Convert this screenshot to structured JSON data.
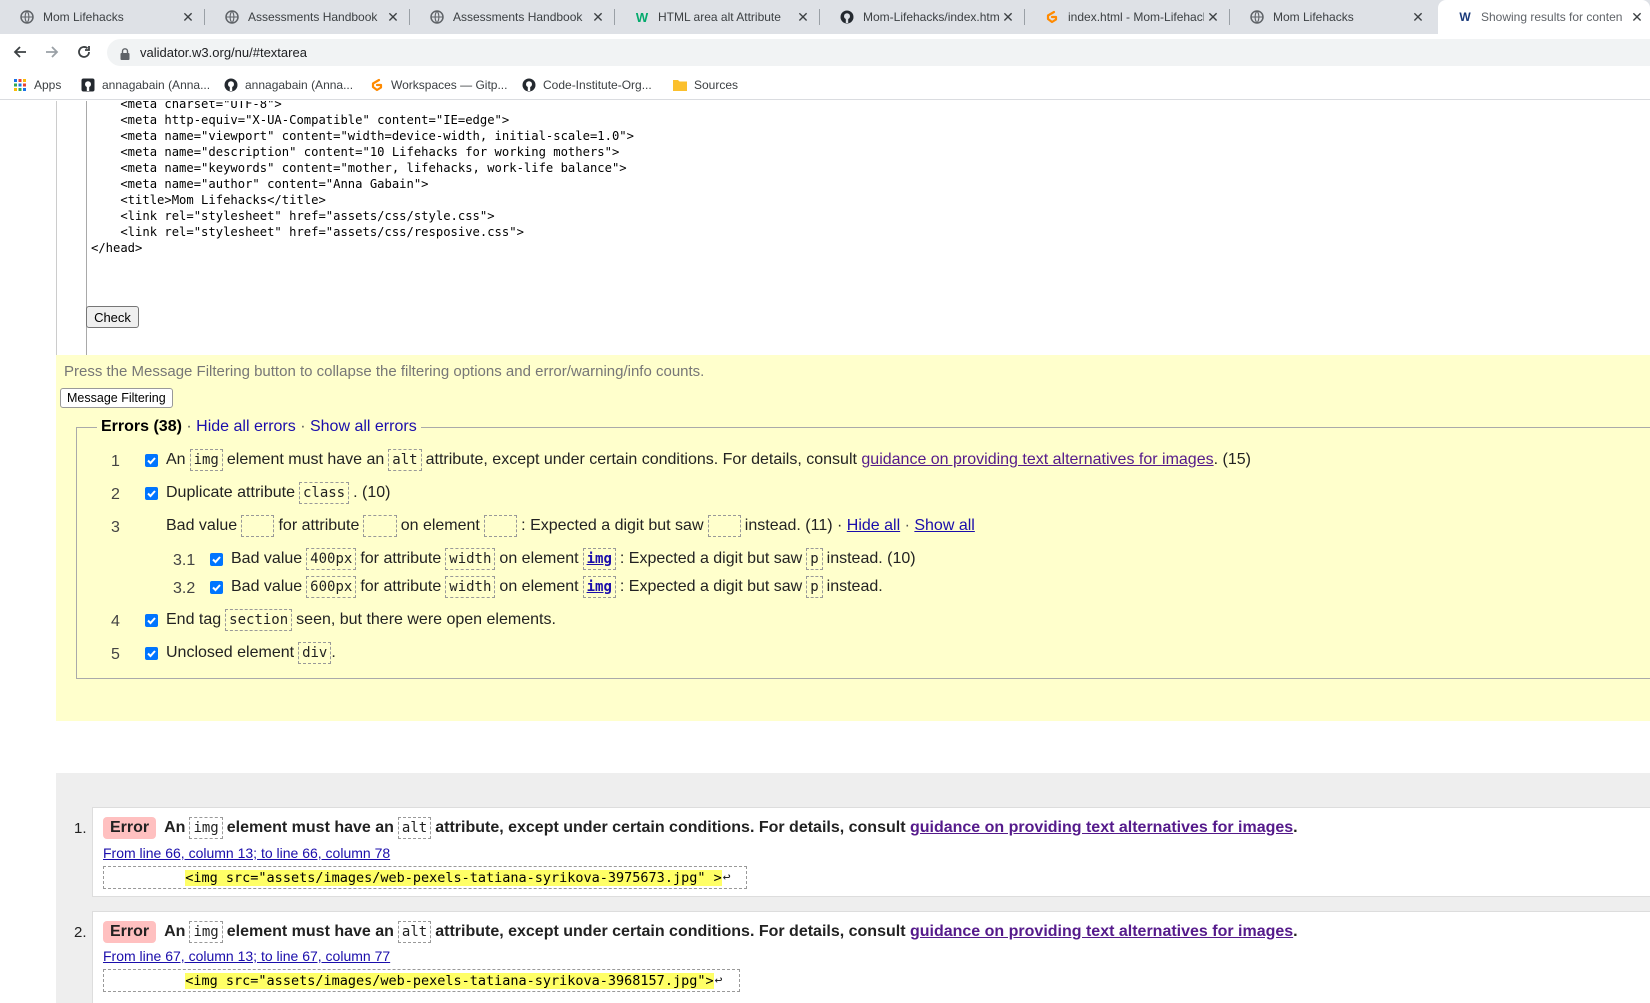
{
  "browser": {
    "tabs": [
      {
        "title": "Mom Lifehacks",
        "icon": "globe-icon"
      },
      {
        "title": "Assessments Handbook",
        "icon": "globe-icon"
      },
      {
        "title": "Assessments Handbook",
        "icon": "globe-icon"
      },
      {
        "title": "HTML area alt Attribute",
        "icon": "w3schools-icon"
      },
      {
        "title": "Mom-Lifehacks/index.html",
        "icon": "github-icon"
      },
      {
        "title": "index.html - Mom-Lifehack",
        "icon": "gitpod-icon"
      },
      {
        "title": "Mom Lifehacks",
        "icon": "globe-icon"
      },
      {
        "title": "Showing results for conten",
        "icon": "w3c-icon"
      }
    ],
    "url": "validator.w3.org/nu/#textarea",
    "bookmarks": [
      {
        "label": "Apps",
        "icon": "apps-grid-icon"
      },
      {
        "label": "annagabain (Anna...",
        "icon": "github-icon"
      },
      {
        "label": "annagabain (Anna...",
        "icon": "github-icon"
      },
      {
        "label": "Workspaces — Gitp...",
        "icon": "gitpod-icon"
      },
      {
        "label": "Code-Institute-Org...",
        "icon": "github-icon"
      },
      {
        "label": "Sources",
        "icon": "folder-icon"
      }
    ]
  },
  "validator": {
    "source_lines": [
      "    <meta charset=\"UTF-8\">",
      "    <meta http-equiv=\"X-UA-Compatible\" content=\"IE=edge\">",
      "    <meta name=\"viewport\" content=\"width=device-width, initial-scale=1.0\">",
      "",
      "    <meta name=\"description\" content=\"10 Lifehacks for working mothers\">",
      "    <meta name=\"keywords\" content=\"mother, lifehacks, work-life balance\">",
      "    <meta name=\"author\" content=\"Anna Gabain\">",
      "    <title>Mom Lifehacks</title>",
      "",
      "    <link rel=\"stylesheet\" href=\"assets/css/style.css\">",
      "    <link rel=\"stylesheet\" href=\"assets/css/resposive.css\">",
      "</head>"
    ],
    "check_label": "Check",
    "filter_hint": "Press the Message Filtering button to collapse the filtering options and error/warning/info counts.",
    "filter_button": "Message Filtering",
    "errors_heading": "Errors (38)",
    "hide_all_errors": "Hide all errors",
    "show_all_errors": "Show all errors",
    "error_groups": {
      "g1": {
        "num": "1",
        "p1": "An",
        "code1": "img",
        "p2": "element must have an",
        "code2": "alt",
        "p3": "attribute, except under certain conditions. For details, consult",
        "link": "guidance on providing text alternatives for images",
        "p4": ". (15)"
      },
      "g2": {
        "num": "2",
        "p1": "Duplicate attribute",
        "code1": "class",
        "p2": ". (10)"
      },
      "g3": {
        "num": "3",
        "p1": "Bad value",
        "p2": "for attribute",
        "p3": "on element",
        "p4": ": Expected a digit but saw",
        "p5": "instead. (11) ·",
        "hide": "Hide all",
        "show": "Show all"
      },
      "g3_1": {
        "num": "3.1",
        "p1": "Bad value",
        "code1": "400px",
        "p2": "for attribute",
        "code2": "width",
        "p3": "on element",
        "code3": "img",
        "p4": ": Expected a digit but saw",
        "code4": "p",
        "p5": "instead. (10)"
      },
      "g3_2": {
        "num": "3.2",
        "p1": "Bad value",
        "code1": "600px",
        "p2": "for attribute",
        "code2": "width",
        "p3": "on element",
        "code3": "img",
        "p4": ": Expected a digit but saw",
        "code4": "p",
        "p5": "instead."
      },
      "g4": {
        "num": "4",
        "p1": "End tag",
        "code1": "section",
        "p2": "seen, but there were open elements."
      },
      "g5": {
        "num": "5",
        "p1": "Unclosed element",
        "code1": "div",
        "p2": "."
      }
    },
    "results": [
      {
        "index": "1.",
        "badge": "Error",
        "p1": "An",
        "code1": "img",
        "p2": "element must have an",
        "code2": "alt",
        "p3": "attribute, except under certain conditions. For details, consult",
        "link": "guidance on providing text alternatives for images",
        "p4": ".",
        "location": "From line 66, column 13; to line 66, column 78",
        "extract_pre": "          ",
        "extract_hl": "<img src=\"assets/images/web-pexels-tatiana-syrikova-3975673.jpg\" >",
        "extract_post": "↩"
      },
      {
        "index": "2.",
        "badge": "Error",
        "p1": "An",
        "code1": "img",
        "p2": "element must have an",
        "code2": "alt",
        "p3": "attribute, except under certain conditions. For details, consult",
        "link": "guidance on providing text alternatives for images",
        "p4": ".",
        "location": "From line 67, column 13; to line 67, column 77",
        "extract_pre": "          ",
        "extract_hl": "<img src=\"assets/images/web-pexels-tatiana-syrikova-3968157.jpg\">",
        "extract_post": "↩"
      }
    ]
  },
  "colors": {
    "filter_panel": "#ffffcc",
    "results_panel": "#eeeeee",
    "error_badge": "#ffc0c0",
    "extract_highlight": "#ffff66",
    "link": "#1a0dab",
    "visited_link": "#551a8b",
    "checkbox": "#0075ff"
  }
}
